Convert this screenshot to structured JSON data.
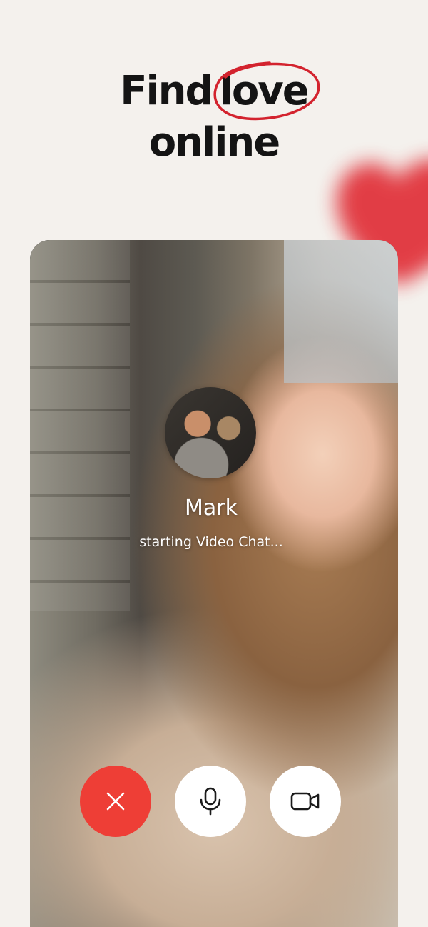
{
  "headline": {
    "word_find": "Find",
    "word_love": "love",
    "word_online": "online"
  },
  "call": {
    "caller_name": "Mark",
    "status": "starting Video Chat..."
  },
  "controls": {
    "end_call_icon": "close-icon",
    "mic_icon": "microphone-icon",
    "camera_icon": "video-camera-icon"
  },
  "colors": {
    "background": "#f4f1ed",
    "headline": "#141414",
    "accent_red": "#d3232e",
    "end_call": "#ee3e36",
    "button_white": "#ffffff",
    "heart": "#e02a33"
  }
}
